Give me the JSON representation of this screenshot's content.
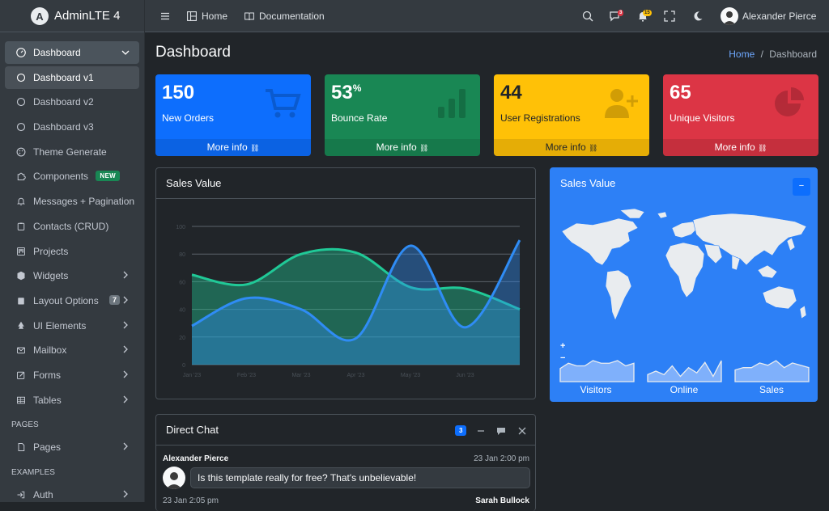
{
  "brand": {
    "name": "AdminLTE 4",
    "logo": "A"
  },
  "sidebar": {
    "items": [
      {
        "label": "Dashboard",
        "icon": "speedometer-icon"
      },
      {
        "label": "Dashboard v1",
        "icon": "circle-icon"
      },
      {
        "label": "Dashboard v2",
        "icon": "circle-icon"
      },
      {
        "label": "Dashboard v3",
        "icon": "circle-icon"
      },
      {
        "label": "Theme Generate",
        "icon": "palette-icon"
      },
      {
        "label": "Components",
        "icon": "puzzle-icon",
        "badge": "NEW"
      },
      {
        "label": "Messages + Pagination",
        "icon": "bell-icon"
      },
      {
        "label": "Contacts (CRUD)",
        "icon": "clipboard-icon"
      },
      {
        "label": "Projects",
        "icon": "kanban-icon"
      },
      {
        "label": "Widgets",
        "icon": "box-icon"
      },
      {
        "label": "Layout Options",
        "icon": "clipboard-fill-icon",
        "badge": "7"
      },
      {
        "label": "UI Elements",
        "icon": "tree-icon"
      },
      {
        "label": "Mailbox",
        "icon": "envelope-icon"
      },
      {
        "label": "Forms",
        "icon": "pencil-square-icon"
      },
      {
        "label": "Tables",
        "icon": "table-icon"
      }
    ],
    "header_pages": "PAGES",
    "pages_item": "Pages",
    "header_examples": "EXAMPLES",
    "auth_item": "Auth"
  },
  "topbar": {
    "home": "Home",
    "documentation": "Documentation",
    "messages_count": "3",
    "notifications_count": "15",
    "user_name": "Alexander Pierce"
  },
  "page": {
    "title": "Dashboard",
    "breadcrumb_home": "Home",
    "breadcrumb_current": "Dashboard"
  },
  "stats": [
    {
      "value": "150",
      "suffix": "",
      "label": "New Orders",
      "more": "More info",
      "color": "#0d6efd",
      "icon": "cart-icon"
    },
    {
      "value": "53",
      "suffix": "%",
      "label": "Bounce Rate",
      "more": "More info",
      "color": "#198754",
      "icon": "bar-chart-icon"
    },
    {
      "value": "44",
      "suffix": "",
      "label": "User Registrations",
      "more": "More info",
      "color": "#ffc107",
      "icon": "person-add-icon"
    },
    {
      "value": "65",
      "suffix": "",
      "label": "Unique Visitors",
      "more": "More info",
      "color": "#dc3545",
      "icon": "pie-chart-icon"
    }
  ],
  "sales_chart": {
    "title": "Sales Value",
    "chart_data": {
      "type": "area",
      "categories": [
        "Jan '23",
        "Feb '23",
        "Mar '23",
        "Apr '23",
        "May '23",
        "Jun '23",
        "Jul '23"
      ],
      "ylim": [
        0,
        100
      ],
      "yticks": [
        "0",
        "20",
        "40",
        "60",
        "80",
        "100"
      ],
      "series": [
        {
          "values": [
            65,
            58,
            80,
            81,
            56,
            55,
            40
          ],
          "color": "#20c997"
        },
        {
          "values": [
            28,
            48,
            40,
            19,
            86,
            27,
            90
          ],
          "color": "#2f8cf5"
        }
      ]
    }
  },
  "map_card": {
    "title": "Sales Value",
    "zoom_in": "+",
    "zoom_out": "−",
    "collapse": "−",
    "sparklines": [
      {
        "label": "Visitors",
        "values": [
          5,
          7,
          6,
          6,
          8,
          7,
          7,
          8,
          6,
          7
        ]
      },
      {
        "label": "Online",
        "values": [
          4,
          6,
          4,
          9,
          3,
          8,
          5,
          11,
          3,
          12
        ]
      },
      {
        "label": "Sales",
        "values": [
          5,
          6,
          6,
          8,
          7,
          9,
          6,
          8,
          7,
          6
        ]
      }
    ]
  },
  "chat": {
    "title": "Direct Chat",
    "count": "3",
    "messages": [
      {
        "name": "Alexander Pierce",
        "time": "23 Jan 2:00 pm",
        "text": "Is this template really for free? That's unbelievable!"
      },
      {
        "name": "Sarah Bullock",
        "time": "23 Jan 2:05 pm"
      }
    ]
  }
}
